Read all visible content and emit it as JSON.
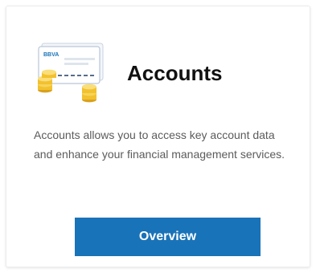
{
  "card": {
    "icon": "bank-card-coins-icon",
    "icon_brand_text": "BBVA",
    "title": "Accounts",
    "description": "Accounts allows you to access key account data and enhance your financial management services.",
    "button_label": "Overview"
  },
  "colors": {
    "button_bg": "#1973b8",
    "button_text": "#ffffff",
    "title": "#111111",
    "description": "#5b5b5b",
    "card_border": "#ececec",
    "coin_gold": "#f2c12e",
    "brand_blue": "#1973b8"
  }
}
